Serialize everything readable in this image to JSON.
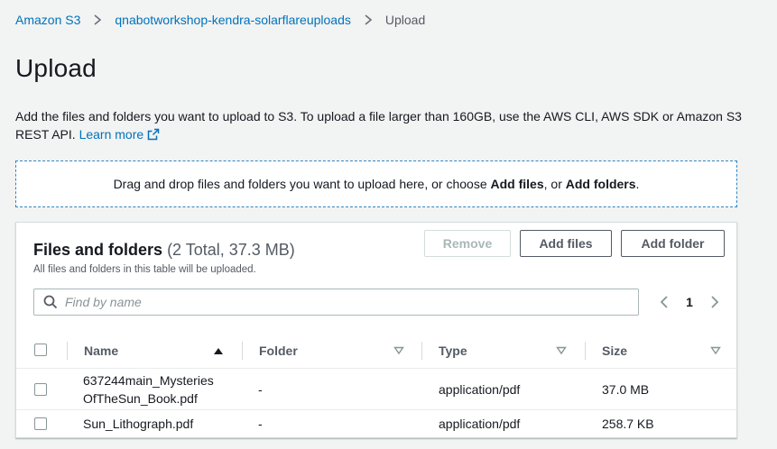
{
  "breadcrumb": {
    "items": [
      "Amazon S3",
      "qnabotworkshop-kendra-solarflareuploads"
    ],
    "current": "Upload"
  },
  "page": {
    "title": "Upload",
    "description": "Add the files and folders you want to upload to S3. To upload a file larger than 160GB, use the AWS CLI, AWS SDK or Amazon S3 REST API.",
    "learn_more": "Learn more"
  },
  "dropzone": {
    "text_before": "Drag and drop files and folders you want to upload here, or choose ",
    "add_files": "Add files",
    "text_middle": ", or ",
    "add_folders": "Add folders",
    "text_after": "."
  },
  "files_panel": {
    "title": "Files and folders",
    "count": "(2 Total, 37.3 MB)",
    "subtitle": "All files and folders in this table will be uploaded.",
    "buttons": {
      "remove": "Remove",
      "add_files": "Add files",
      "add_folder": "Add folder"
    },
    "search_placeholder": "Find by name",
    "page_number": "1",
    "columns": [
      "Name",
      "Folder",
      "Type",
      "Size"
    ],
    "rows": [
      {
        "name_line1": "637244main_Mysteries",
        "name_line2": "OfTheSun_Book.pdf",
        "folder": "-",
        "type": "application/pdf",
        "size": "37.0 MB"
      },
      {
        "name_line1": "Sun_Lithograph.pdf",
        "name_line2": "",
        "folder": "-",
        "type": "application/pdf",
        "size": "258.7 KB"
      }
    ]
  },
  "colors": {
    "link": "#0073bb",
    "dropzone_border": "#3184c2",
    "background": "#f2f3f3"
  },
  "icons": [
    "chevron-right-icon",
    "external-link-icon",
    "search-icon",
    "chevron-left-icon",
    "sort-ascending-icon",
    "sort-descending-icon"
  ]
}
